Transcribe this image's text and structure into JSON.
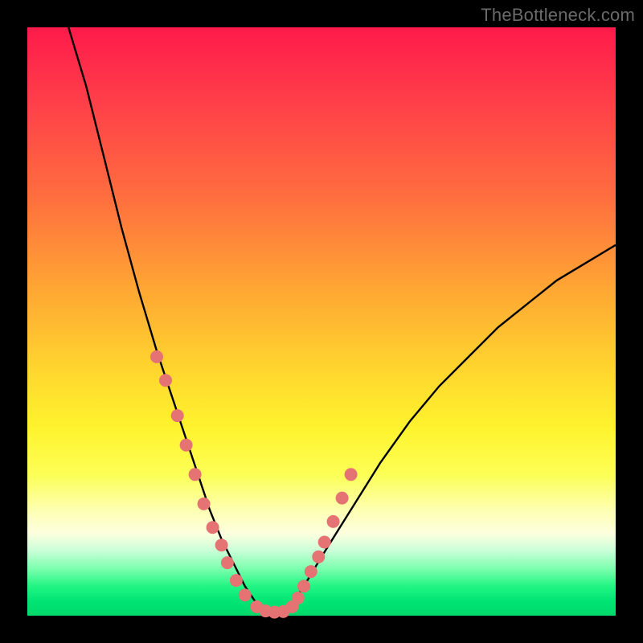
{
  "watermark": "TheBottleneck.com",
  "chart_data": {
    "type": "line",
    "title": "",
    "xlabel": "",
    "ylabel": "",
    "xlim": [
      0,
      100
    ],
    "ylim": [
      0,
      100
    ],
    "series": [
      {
        "name": "bottleneck-curve",
        "x": [
          7,
          10,
          13,
          16,
          19,
          22,
          25,
          27,
          29,
          31,
          33,
          35,
          37,
          39,
          41,
          43,
          45,
          47,
          50,
          55,
          60,
          65,
          70,
          75,
          80,
          85,
          90,
          95,
          100
        ],
        "y": [
          100,
          90,
          78,
          66,
          55,
          45,
          36,
          30,
          24,
          18,
          13,
          9,
          5,
          2,
          0.5,
          0.5,
          2,
          5,
          10,
          18,
          26,
          33,
          39,
          44,
          49,
          53,
          57,
          60,
          63
        ]
      }
    ],
    "highlight_points": {
      "name": "sample-dots",
      "x": [
        22.0,
        23.5,
        25.5,
        27.0,
        28.5,
        30.0,
        31.5,
        33.0,
        34.0,
        35.5,
        37.0,
        39.0,
        40.5,
        42.0,
        43.5,
        45.0,
        46.0,
        47.0,
        48.2,
        49.5,
        50.5,
        52.0,
        53.5,
        55.0
      ],
      "y": [
        44.0,
        40.0,
        34.0,
        29.0,
        24.0,
        19.0,
        15.0,
        12.0,
        9.0,
        6.0,
        3.5,
        1.5,
        0.8,
        0.6,
        0.7,
        1.5,
        3.0,
        5.0,
        7.5,
        10.0,
        12.5,
        16.0,
        20.0,
        24.0
      ]
    },
    "colors": {
      "curve": "#000000",
      "dots": "#e57373",
      "gradient_top": "#ff1a4b",
      "gradient_bottom": "#00d96c"
    }
  }
}
